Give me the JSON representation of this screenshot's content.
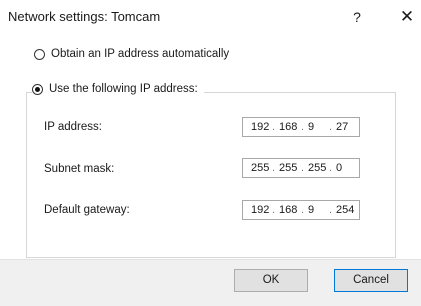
{
  "window": {
    "title": "Network settings: Tomcam",
    "help_label": "?",
    "close_label": "✕"
  },
  "options": {
    "auto": {
      "label": "Obtain an IP address automatically",
      "selected": false
    },
    "manual": {
      "label": "Use the following IP address:",
      "selected": true
    }
  },
  "fields": {
    "ip_address": {
      "label": "IP address:",
      "octets": [
        "192",
        "168",
        "9",
        "27"
      ]
    },
    "subnet_mask": {
      "label": "Subnet mask:",
      "octets": [
        "255",
        "255",
        "255",
        "0"
      ]
    },
    "default_gateway": {
      "label": "Default gateway:",
      "octets": [
        "192",
        "168",
        "9",
        "254"
      ]
    }
  },
  "octet_separator": ".",
  "buttons": {
    "ok": "OK",
    "cancel": "Cancel"
  },
  "colors": {
    "footer_bg": "#f0f0f0",
    "button_bg": "#e1e1e1",
    "cancel_border": "#0078d7"
  }
}
